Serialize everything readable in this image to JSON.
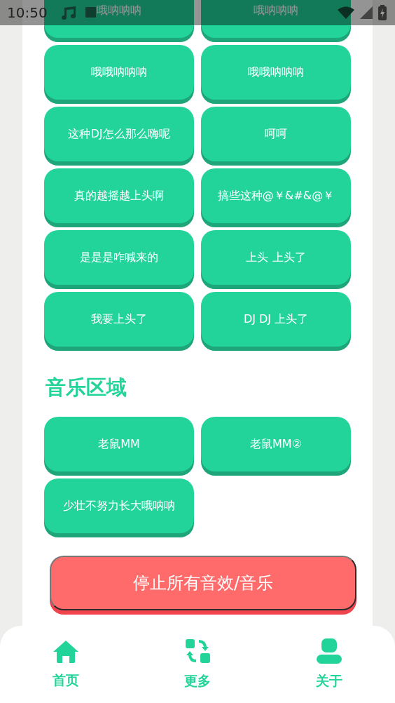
{
  "status_bar": {
    "time": "10:50"
  },
  "sound_buttons": [
    {
      "label": "哦呐呐呐"
    },
    {
      "label": "哦呐呐呐"
    },
    {
      "label": "哦哦呐呐呐"
    },
    {
      "label": "哦哦呐呐呐"
    },
    {
      "label": "这种DJ怎么那么嗨呢"
    },
    {
      "label": "呵呵"
    },
    {
      "label": "真的越摇越上头啊"
    },
    {
      "label": "搞些这种@￥&#&@￥"
    },
    {
      "label": "是是是咋喊来的"
    },
    {
      "label": "上头 上头了"
    },
    {
      "label": "我要上头了"
    },
    {
      "label": "DJ DJ 上头了"
    }
  ],
  "music_section": {
    "title": "音乐区域",
    "buttons": [
      {
        "label": "老鼠MM"
      },
      {
        "label": "老鼠MM②"
      },
      {
        "label": "少壮不努力长大哦呐呐"
      }
    ]
  },
  "stop_button": {
    "label": "停止所有音效/音乐"
  },
  "tab_bar": [
    {
      "kind": "home",
      "label": "首页"
    },
    {
      "kind": "more",
      "label": "更多"
    },
    {
      "kind": "about",
      "label": "关于"
    }
  ]
}
